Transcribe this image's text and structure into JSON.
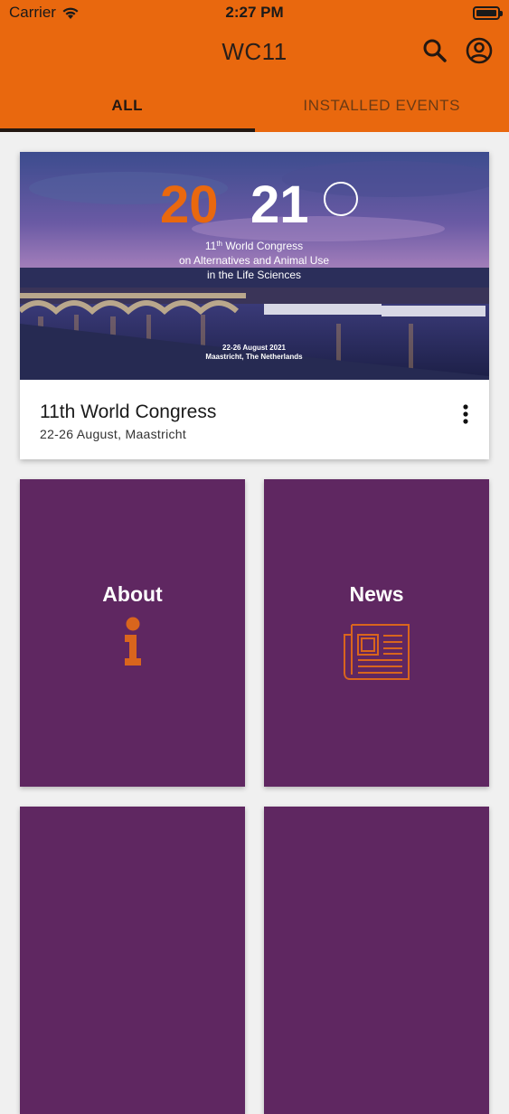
{
  "status_bar": {
    "carrier": "Carrier",
    "time": "2:27 PM"
  },
  "header": {
    "title": "WC11",
    "search_icon": "search-icon",
    "account_icon": "account-icon"
  },
  "tabs": [
    {
      "label": "ALL",
      "active": true
    },
    {
      "label": "INSTALLED EVENTS",
      "active": false
    }
  ],
  "event_card": {
    "banner": {
      "year": "2021",
      "line1_prefix": "11",
      "line1_sup": "th",
      "line1_suffix": " World Congress",
      "line2": "on Alternatives and Animal Use",
      "line3": "in the Life Sciences",
      "dates": "22-26 August 2021",
      "place": "Maastricht, The Netherlands"
    },
    "title": "11th World Congress",
    "subtitle": "22-26 August, Maastricht",
    "menu_icon": "more-vert-icon"
  },
  "tiles": [
    {
      "label": "About",
      "icon": "info-icon"
    },
    {
      "label": "News",
      "icon": "newspaper-icon"
    },
    {
      "label": "",
      "icon": ""
    },
    {
      "label": "",
      "icon": ""
    }
  ],
  "colors": {
    "header": "#e9680e",
    "tile": "#5f2761",
    "icon_orange": "#d9651d",
    "background": "#f0f0f0"
  }
}
